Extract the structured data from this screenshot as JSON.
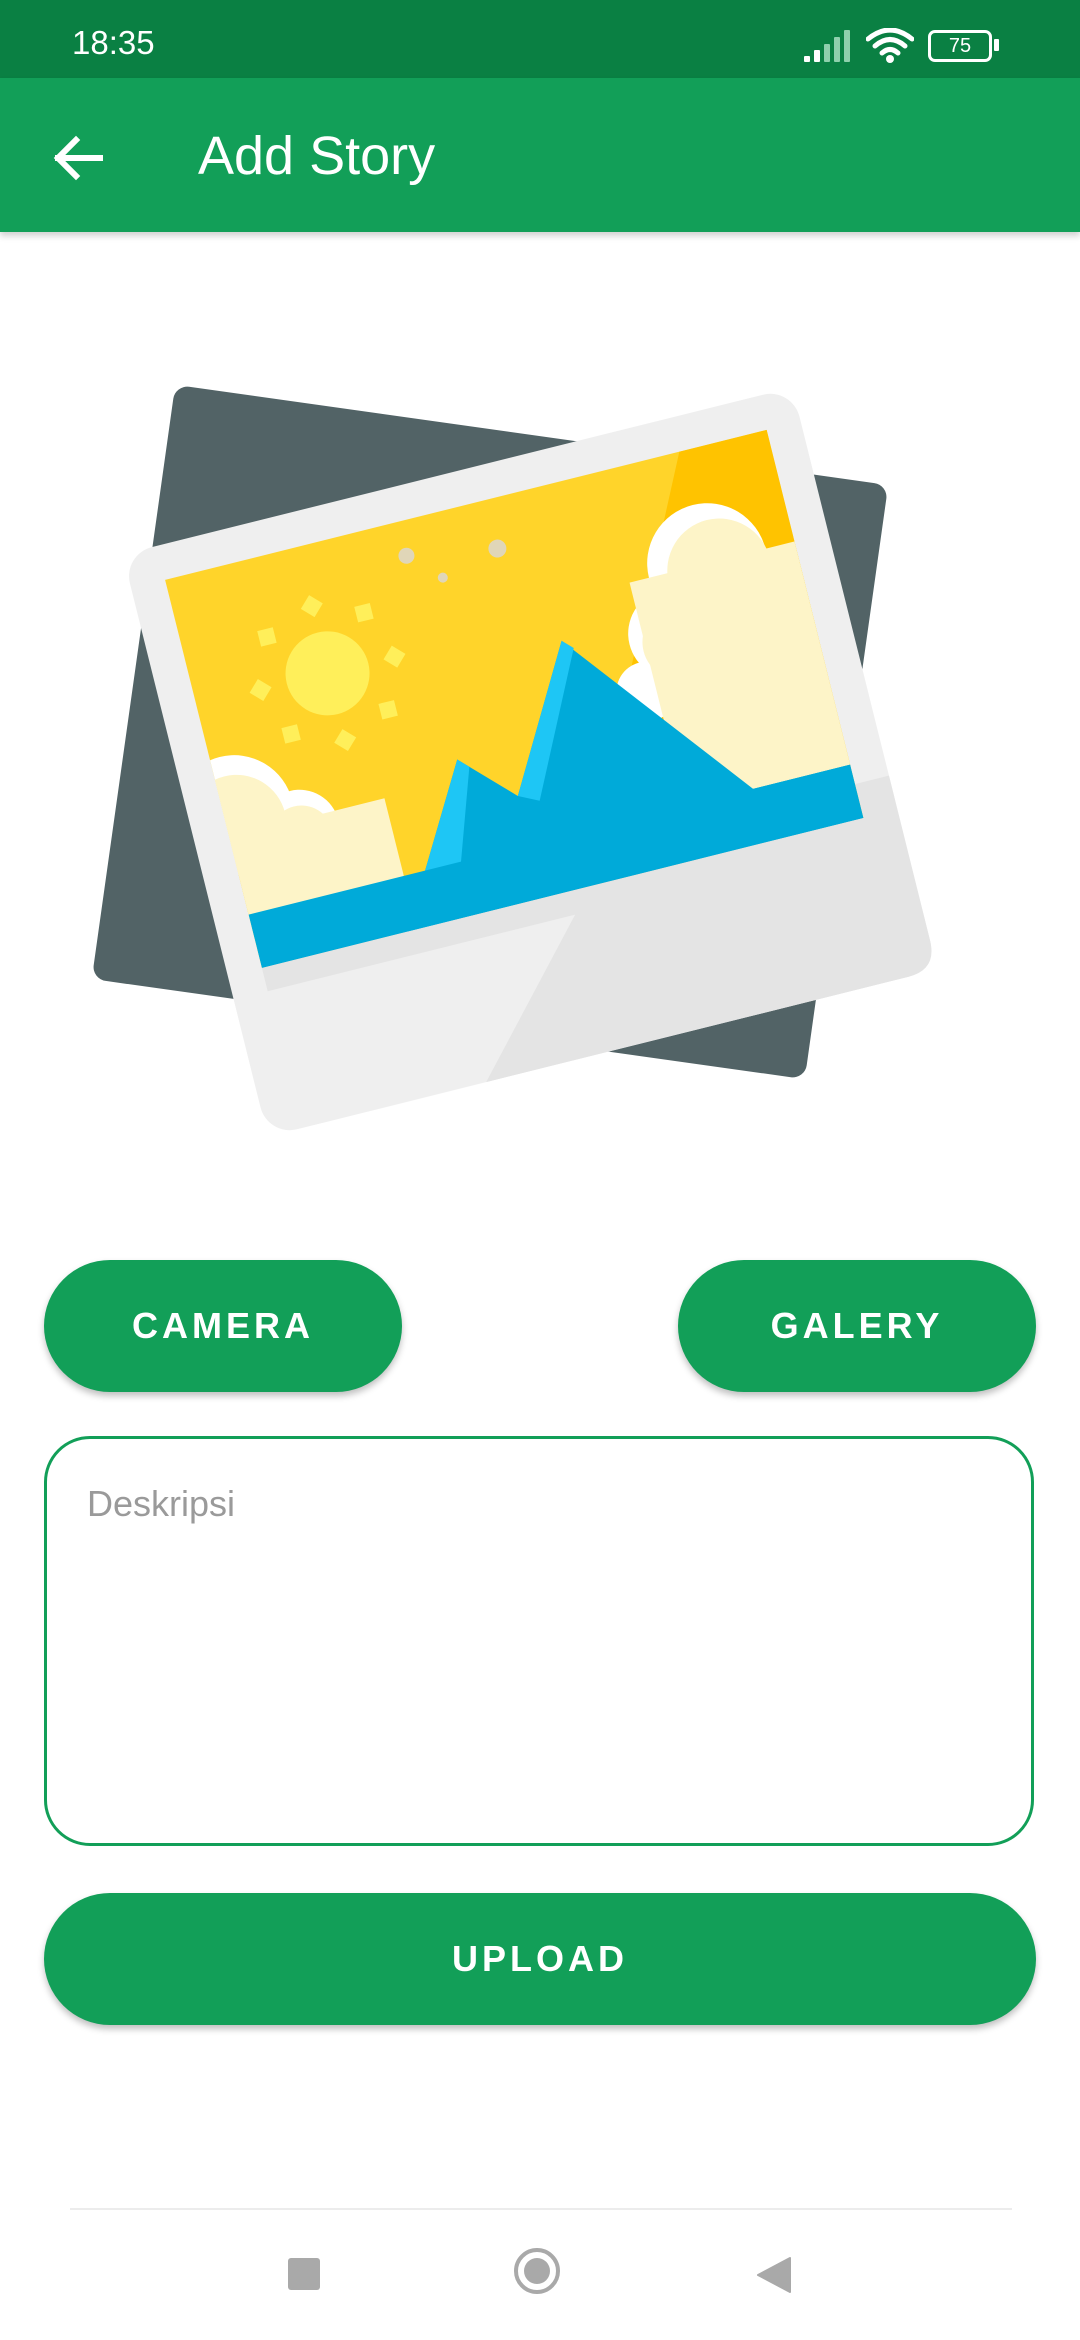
{
  "status_bar": {
    "time": "18:35",
    "battery_level": "75",
    "icons": [
      "signal-icon",
      "wifi-icon",
      "battery-icon"
    ]
  },
  "app_bar": {
    "title": "Add Story",
    "back_icon": "arrow-left-icon",
    "color": "#129f58"
  },
  "preview": {
    "icon": "image-placeholder-icon"
  },
  "buttons": {
    "camera_label": "CAMERA",
    "galery_label": "GALERY",
    "upload_label": "UPLOAD"
  },
  "description": {
    "placeholder": "Deskripsi",
    "value": ""
  },
  "navigation": {
    "icons": [
      "recents-square-icon",
      "home-circle-icon",
      "back-triangle-icon"
    ]
  },
  "colors": {
    "primary": "#129f58",
    "status_bar": "#0a8043"
  }
}
